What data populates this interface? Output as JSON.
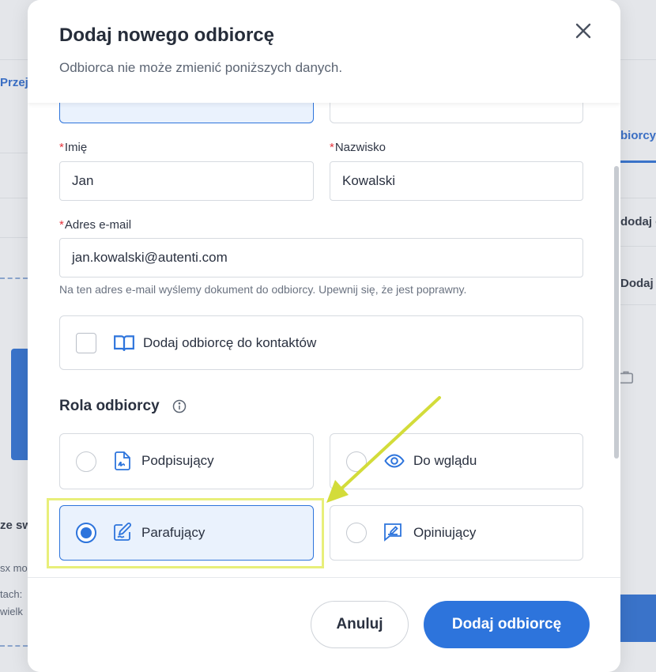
{
  "background": {
    "fragments": [
      "Przej",
      "biorcy",
      "dodaj o",
      "Dodaj o",
      "ze sw",
      "sx mo",
      "tach:",
      "wielk"
    ]
  },
  "modal": {
    "title": "Dodaj nowego odbiorcę",
    "subtitle": "Odbiorca nie może zmienić poniższych danych.",
    "close_icon": "close-icon"
  },
  "form": {
    "first_name": {
      "label": "Imię",
      "value": "Jan"
    },
    "last_name": {
      "label": "Nazwisko",
      "value": "Kowalski"
    },
    "email": {
      "label": "Adres e-mail",
      "value": "jan.kowalski@autenti.com",
      "hint": "Na ten adres e-mail wyślemy dokument do odbiorcy. Upewnij się, że jest poprawny."
    },
    "add_to_contacts": {
      "label": "Dodaj odbiorcę do kontaktów",
      "checked": false,
      "icon": "book-icon"
    }
  },
  "role": {
    "title": "Rola odbiorcy",
    "info_icon": "info-icon",
    "options": [
      {
        "label": "Podpisujący",
        "icon": "signature-document-icon",
        "selected": false
      },
      {
        "label": "Do wglądu",
        "icon": "eye-icon",
        "selected": false
      },
      {
        "label": "Parafujący",
        "icon": "initial-pen-icon",
        "selected": true
      },
      {
        "label": "Opiniujący",
        "icon": "comment-pen-icon",
        "selected": false
      }
    ]
  },
  "footer": {
    "cancel_label": "Anuluj",
    "submit_label": "Dodaj odbiorcę"
  },
  "colors": {
    "accent": "#2d74dc",
    "required": "#e5343d",
    "annotation": "#d3dc3a"
  }
}
